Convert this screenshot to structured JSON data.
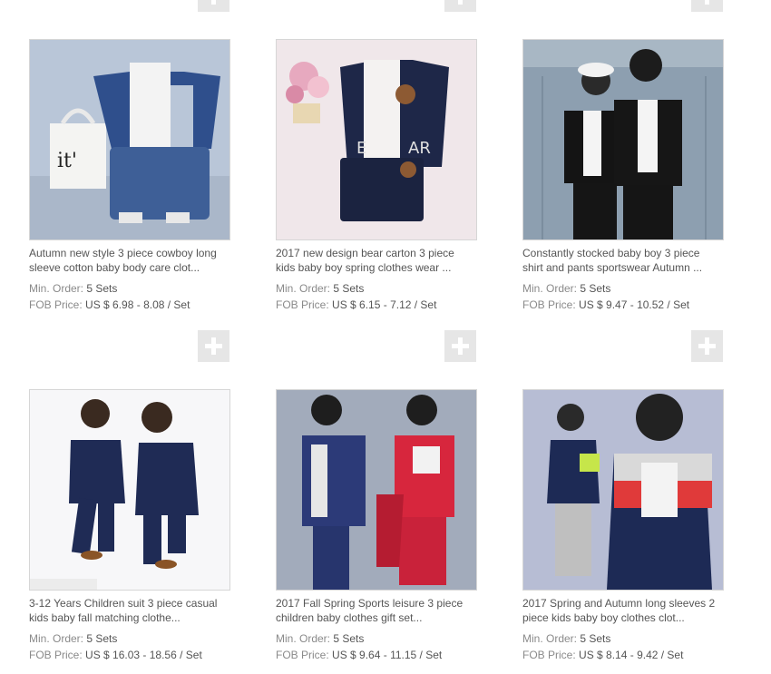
{
  "products": [
    {
      "title_line1": "Autumn new style 3 piece cowboy long",
      "title_line2": "sleeve cotton baby body care clot...",
      "min_order_label": "Min. Order:",
      "min_order_value": "5 Sets",
      "fob_label": "FOB Price:",
      "fob_value": "US $ 6.98 - 8.08 / Set"
    },
    {
      "title_line1": "2017 new design bear carton 3 piece",
      "title_line2": "kids baby boy spring clothes wear ...",
      "min_order_label": "Min. Order:",
      "min_order_value": "5 Sets",
      "fob_label": "FOB Price:",
      "fob_value": "US $ 6.15 - 7.12 / Set"
    },
    {
      "title_line1": "Constantly stocked baby boy 3 piece",
      "title_line2": "shirt and pants sportswear Autumn ...",
      "min_order_label": "Min. Order:",
      "min_order_value": "5 Sets",
      "fob_label": "FOB Price:",
      "fob_value": "US $ 9.47 - 10.52 / Set"
    },
    {
      "title_line1": "3-12 Years Children suit 3 piece casual",
      "title_line2": "kids baby fall matching clothe...",
      "min_order_label": "Min. Order:",
      "min_order_value": "5 Sets",
      "fob_label": "FOB Price:",
      "fob_value": "US $ 16.03 - 18.56 / Set"
    },
    {
      "title_line1": "2017 Fall Spring Sports leisure 3 piece",
      "title_line2": "children baby clothes gift set...",
      "min_order_label": "Min. Order:",
      "min_order_value": "5 Sets",
      "fob_label": "FOB Price:",
      "fob_value": "US $ 9.64 - 11.15 / Set"
    },
    {
      "title_line1": "2017 Spring and Autumn long sleeves 2",
      "title_line2": "piece kids baby boy clothes clot...",
      "min_order_label": "Min. Order:",
      "min_order_value": "5 Sets",
      "fob_label": "FOB Price:",
      "fob_value": "US $ 8.14 - 9.42 / Set"
    }
  ],
  "icons": {
    "add": "plus-icon"
  },
  "colors": {
    "add_button_bg": "#e6e6e6",
    "label": "#8a8a8a",
    "text": "#555555"
  }
}
